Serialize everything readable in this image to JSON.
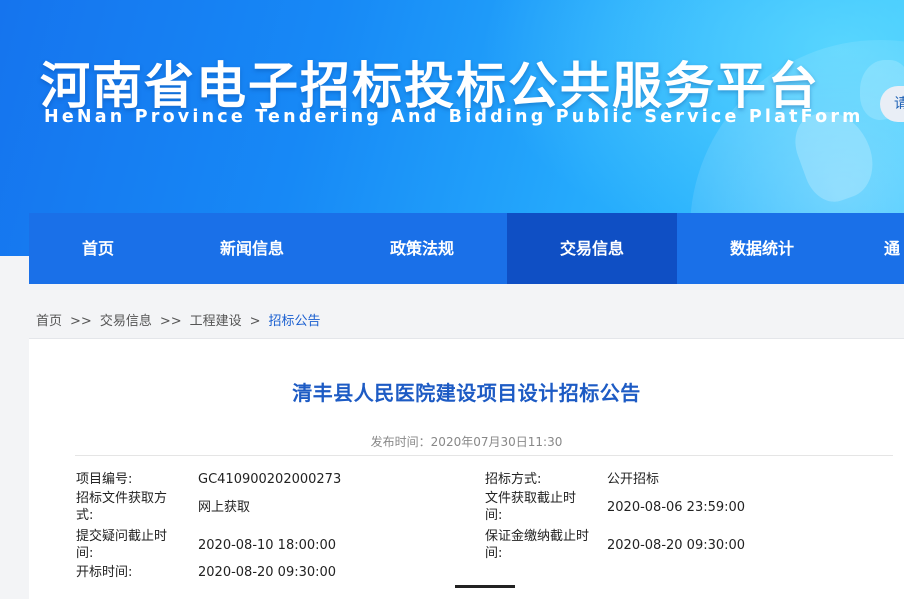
{
  "header": {
    "title": "河南省电子招标投标公共服务平台",
    "subtitle": "HeNan Province Tendering And Bidding Public Service PlatForm",
    "login_fragment": "请"
  },
  "nav": {
    "items": [
      {
        "label": "首页"
      },
      {
        "label": "新闻信息"
      },
      {
        "label": "政策法规"
      },
      {
        "label": "交易信息",
        "active": true
      },
      {
        "label": "数据统计"
      },
      {
        "label": "通"
      }
    ]
  },
  "breadcrumb": {
    "items": [
      "首页",
      "交易信息",
      "工程建设",
      "招标公告"
    ],
    "separators": [
      ">>",
      ">>",
      ">"
    ]
  },
  "article": {
    "title": "清丰县人民医院建设项目设计招标公告",
    "publish_label": "发布时间：",
    "publish_time": "2020年07月30日11:30",
    "info": {
      "project_no_label": "项目编号:",
      "project_no": "GC410900202000273",
      "bid_method_label": "招标方式:",
      "bid_method": "公开招标",
      "doc_obtain_method_label": "招标文件获取方式:",
      "doc_obtain_method": "网上获取",
      "doc_deadline_label": "文件获取截止时间:",
      "doc_deadline": "2020-08-06 23:59:00",
      "question_deadline_label": "提交疑问截止时间:",
      "question_deadline": "2020-08-10 18:00:00",
      "deposit_deadline_label": "保证金缴纳截止时间:",
      "deposit_deadline": "2020-08-20 09:30:00",
      "opening_time_label": "开标时间:",
      "opening_time": "2020-08-20 09:30:00"
    }
  },
  "colors": {
    "nav_bg": "#1a70e8",
    "nav_active": "#0f4fc4",
    "title_blue": "#1d5bc4",
    "breadcrumb_current": "#1a5fd0"
  }
}
